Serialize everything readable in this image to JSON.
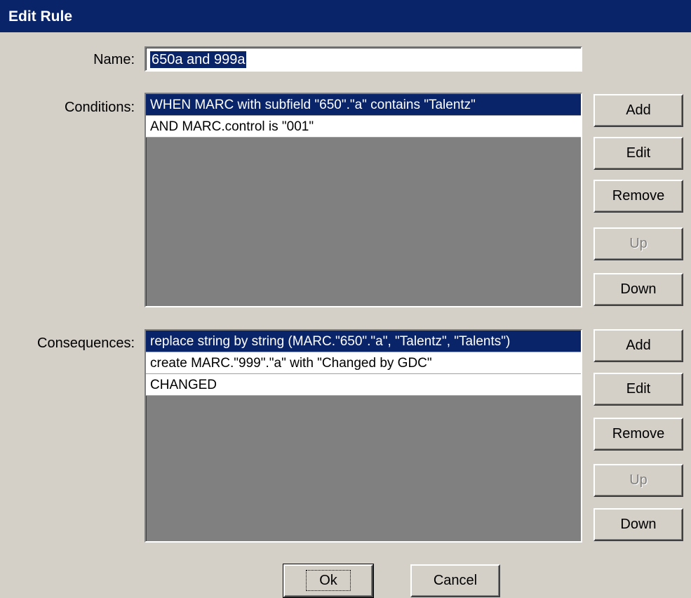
{
  "window": {
    "title": "Edit Rule"
  },
  "name_field": {
    "label": "Name:",
    "value": "650a and 999a"
  },
  "conditions": {
    "label": "Conditions:",
    "items": [
      "WHEN  MARC with subfield \"650\".\"a\" contains \"Talentz\"",
      "AND  MARC.control is \"001\""
    ],
    "selected_index": 0,
    "buttons": {
      "add": "Add",
      "edit": "Edit",
      "remove": "Remove",
      "up": "Up",
      "down": "Down"
    }
  },
  "consequences": {
    "label": "Consequences:",
    "items": [
      "replace string by string (MARC.\"650\".\"a\", \"Talentz\", \"Talents\")",
      "create MARC.\"999\".\"a\" with \"Changed by GDC\"",
      "CHANGED"
    ],
    "selected_index": 0,
    "buttons": {
      "add": "Add",
      "edit": "Edit",
      "remove": "Remove",
      "up": "Up",
      "down": "Down"
    }
  },
  "footer": {
    "ok": "Ok",
    "cancel": "Cancel"
  },
  "colors": {
    "title_bar": "#0a246a",
    "dialog_bg": "#d4d0c8",
    "selection": "#0a246a",
    "list_empty": "#808080"
  }
}
